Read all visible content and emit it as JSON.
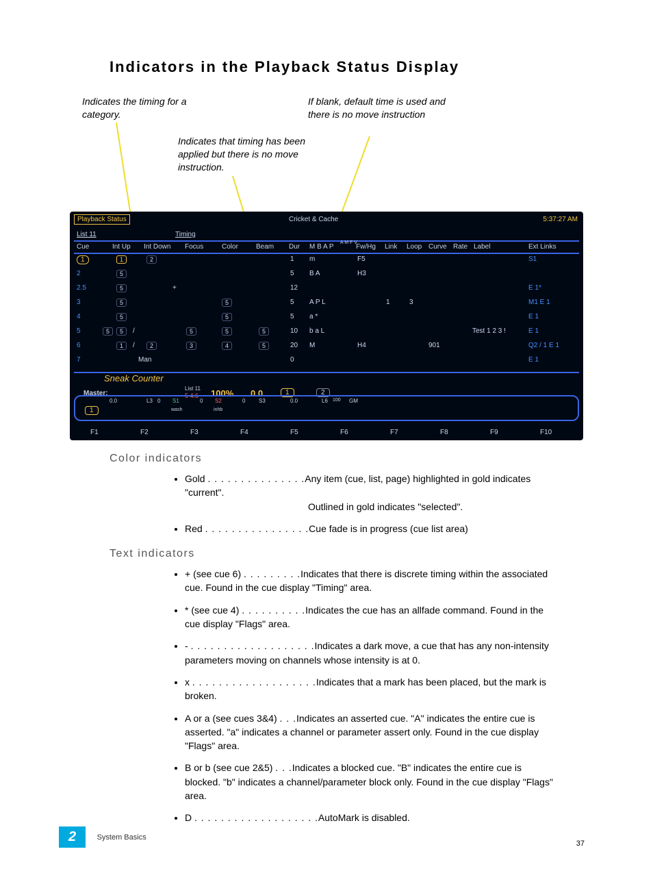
{
  "title": "Indicators in the Playback Status Display",
  "notes": {
    "n1": "Indicates the timing for a category.",
    "n2": "Indicates that timing has been applied but there is no move instruction.",
    "n3": "If blank, default time is used and there is no move instruction"
  },
  "screenshot": {
    "tabTitle": "Playback Status",
    "centerTitle": "Cricket & Cache",
    "clock": "5:37:27 AM",
    "listLabel": "List 11",
    "timingLabel": "Timing",
    "headers": [
      "Cue",
      "",
      "Int Up",
      "Int Down",
      "Focus",
      "Color",
      "Beam",
      "Dur",
      "M B A P",
      "Fw/Hg",
      "Link",
      "Loop",
      "Curve",
      "Rate",
      "Label",
      "Ext Links"
    ],
    "flagsSub": "A M\nF V",
    "rows": [
      {
        "cue": "1",
        "intUp": "1",
        "intDown": "2",
        "dur": "1",
        "flags": "m",
        "fwhg": "F5",
        "ext": "S1"
      },
      {
        "cue": "2",
        "intUp": "5",
        "dur": "5",
        "flags": "B A",
        "fwhg": "H3",
        "ext": ""
      },
      {
        "cue": "2.5",
        "intUp": "5",
        "plus": "+",
        "dur": "12",
        "ext": "E 1*"
      },
      {
        "cue": "3",
        "intUp": "5",
        "color": "5",
        "dur": "5",
        "flags": "A P     L",
        "link": "1",
        "loop": "3",
        "ext": "M1 E 1"
      },
      {
        "cue": "4",
        "intUp": "5",
        "color": "5",
        "dur": "5",
        "flags": "a     *",
        "ext": "E 1"
      },
      {
        "cue": "5",
        "intUp": "5",
        "intUpPre": "5",
        "slash": "/",
        "focus": "5",
        "color": "5",
        "beam": "5",
        "dur": "10",
        "flags": "b a     L",
        "label": "Test 1 2 3 !",
        "ext": "E 1"
      },
      {
        "cue": "6",
        "intUp": "1",
        "slash": "/",
        "intDown": "2",
        "focus": "3",
        "color": "4",
        "beam": "5",
        "dur": "20",
        "flags": "M",
        "fwhg": "H4",
        "curve": "901",
        "ext": "Q2 / 1 E 1"
      },
      {
        "cue": "7",
        "man": "Man",
        "dur": "0",
        "ext": "E 1"
      }
    ],
    "sneak": "Sneak Counter",
    "master": {
      "label": "Master:",
      "list": "List 11",
      "val": "5 4.6",
      "pct": "100%",
      "zero": "0.0",
      "g1": "1",
      "g2": "2"
    },
    "faderTop": {
      "v1": "0.0",
      "v2": "L3",
      "sub": "0",
      "s1": "S1",
      "wash": "wash",
      "s2": "S2",
      "inhb": "inhb",
      "s3": "S3",
      "r0": "0.0",
      "l6": "L6",
      "h": "100",
      "gm": "GM"
    },
    "faderOne": "1",
    "fkeys": [
      "F1",
      "F2",
      "F3",
      "F4",
      "F5",
      "F6",
      "F7",
      "F8",
      "F9",
      "F10"
    ]
  },
  "colorHdr": "Color indicators",
  "colorItems": [
    {
      "term": "Gold",
      "dots": ". . . . . . . . . . . . . . .",
      "desc": "Any item (cue, list, page) highlighted in gold indicates \"current\".\nOutlined in gold indicates \"selected\"."
    },
    {
      "term": "Red",
      "dots": ". . . . . . . . . . . . . . . .",
      "desc": "Cue fade is in progress (cue list area)"
    }
  ],
  "textHdr": "Text indicators",
  "textItems": [
    {
      "term": "+ (see cue 6)",
      "dots": " . . . . . . . . .",
      "desc": "Indicates that there is discrete timing within the associated cue. Found in the cue display \"Timing\" area."
    },
    {
      "term": "* (see cue 4)",
      "dots": ". . . . . . . . . .",
      "desc": "Indicates the cue has an allfade command. Found in the cue display \"Flags\" area."
    },
    {
      "term": "-",
      "dots": " . . . . . . . . . . . . . . . . . . .",
      "desc": "Indicates a dark move, a cue that has any non-intensity parameters moving on channels whose intensity is at 0."
    },
    {
      "term": "x",
      "dots": " . . . . . . . . . . . . . . . . . . .",
      "desc": "Indicates that a mark has been placed, but the mark is broken."
    },
    {
      "term": "A or a (see cues 3&4)",
      "dots": ". . .",
      "desc": "Indicates an asserted cue. \"A\" indicates the entire cue is asserted. \"a\" indicates a channel or parameter assert only. Found in the cue display \"Flags\" area."
    },
    {
      "term": "B or b (see cue 2&5)",
      "dots": " . . .",
      "desc": "Indicates a blocked cue. \"B\" indicates the entire cue is blocked. \"b\" indicates a channel/parameter block only. Found in the cue display \"Flags\" area."
    },
    {
      "term": "D",
      "dots": ". . . . . . . . . . . . . . . . . . .",
      "desc": "AutoMark is disabled."
    }
  ],
  "chapter": "2",
  "footer": "System Basics",
  "page": "37"
}
